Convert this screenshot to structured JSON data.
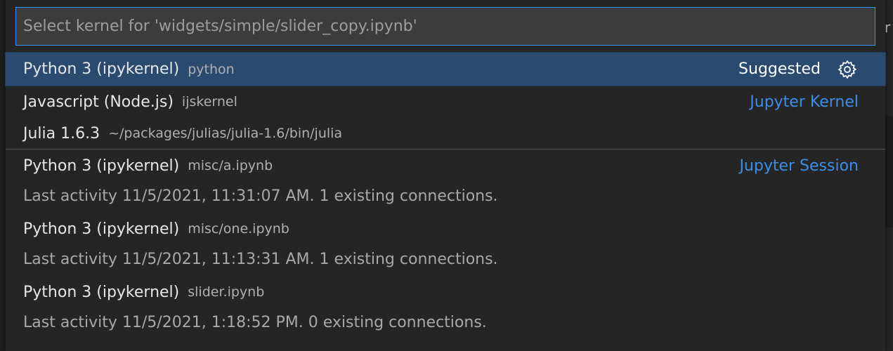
{
  "search": {
    "placeholder": "Select kernel for 'widgets/simple/slider_copy.ipynb'"
  },
  "edge_char": "r",
  "items": [
    {
      "label": "Python 3 (ipykernel)",
      "description": "python",
      "tag": "Suggested",
      "icon": "gear-icon",
      "selected": true
    },
    {
      "label": "Javascript (Node.js)",
      "description": "ijskernel",
      "group": "Jupyter Kernel"
    },
    {
      "label": "Julia 1.6.3",
      "description": "~/packages/julias/julia-1.6/bin/julia"
    },
    {
      "label": "Python 3 (ipykernel)",
      "description": "misc/a.ipynb",
      "group": "Jupyter Session",
      "detail": "Last activity 11/5/2021, 11:31:07 AM. 1 existing connections."
    },
    {
      "label": "Python 3 (ipykernel)",
      "description": "misc/one.ipynb",
      "detail": "Last activity 11/5/2021, 11:13:31 AM. 1 existing connections."
    },
    {
      "label": "Python 3 (ipykernel)",
      "description": "slider.ipynb",
      "detail": "Last activity 11/5/2021, 1:18:52 PM. 0 existing connections."
    }
  ],
  "colors": {
    "accent": "#3794ff",
    "selection": "#2b4a6f",
    "group_label": "#3b8eea"
  }
}
